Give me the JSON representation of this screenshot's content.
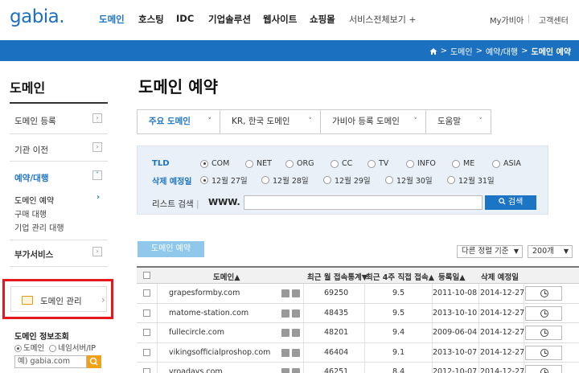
{
  "header": {
    "logo": "gabia.",
    "nav": [
      "도메인",
      "호스팅",
      "IDC",
      "기업솔루션",
      "웹사이트",
      "쇼핑몰",
      "서비스전체보기 +"
    ],
    "my_link": "My가비아",
    "support_link": "고객센터"
  },
  "breadcrumb": {
    "items": [
      "도메인",
      "예약/대행",
      "도메인 예약"
    ],
    "sep": ">"
  },
  "sidebar": {
    "title": "도메인",
    "items": [
      {
        "label": "도메인 등록"
      },
      {
        "label": "기관 이전"
      },
      {
        "label": "예약/대행"
      }
    ],
    "subitems": [
      "도메인 예약",
      "구매 대행",
      "기업 관리 대행"
    ],
    "extra_item": "부가서비스",
    "manage_label": "도메인 관리",
    "info_title": "도메인 정보조회",
    "radio_options": [
      "도메인",
      "네임서버/IP"
    ],
    "search_value": "예) gabia.com"
  },
  "main": {
    "title": "도메인 예약",
    "tabs": [
      "주요 도메인",
      "KR, 한국 도메인",
      "가비아 등록 도메인",
      "도움말"
    ],
    "filter": {
      "tld_label": "TLD",
      "tld_options": [
        "COM",
        "NET",
        "ORG",
        "CC",
        "TV",
        "INFO",
        "ME",
        "ASIA"
      ],
      "date_label": "삭제 예정일",
      "date_options": [
        "12월 27일",
        "12월 28일",
        "12월 29일",
        "12월 30일",
        "12월 31일"
      ],
      "list_label": "리스트 검색",
      "list_sep": "|",
      "www": "WWW.",
      "search_button": "검색"
    },
    "reserve_button": "도메인 예약",
    "sort_select": "다른 정렬 기준",
    "count_select": "200개",
    "table": {
      "headers": [
        "도메인",
        "최근 월 접속통계",
        "최근 4주 직접 접속",
        "등록일",
        "삭제 예정일"
      ],
      "rows": [
        [
          "grapesformby.com",
          "69250",
          "9.5",
          "2011-10-08",
          "2014-12-27"
        ],
        [
          "matome-station.com",
          "48435",
          "9.5",
          "2013-10-10",
          "2014-12-27"
        ],
        [
          "fullecircle.com",
          "48201",
          "9.4",
          "2009-06-04",
          "2014-12-27"
        ],
        [
          "vikingsofficialproshop.com",
          "46404",
          "9.1",
          "2013-10-07",
          "2014-12-27"
        ],
        [
          "vroadays.com",
          "46251",
          "8.4",
          "2012-10-07",
          "2014-12-27"
        ]
      ]
    }
  },
  "colors": {
    "brand_blue": "#1c70c0",
    "highlight_red": "#e8161e",
    "search_orange": "#f1a019"
  }
}
